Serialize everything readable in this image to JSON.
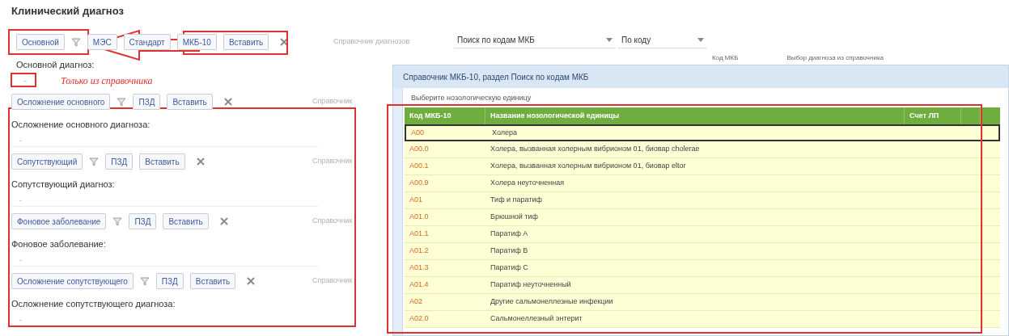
{
  "title": "Клинический диагноз",
  "sections": [
    {
      "buttons": [
        "Основной",
        "МЭС",
        "Стандарт",
        "МКБ-10",
        "Вставить"
      ],
      "reference": "Справочник диагнозов",
      "selects": [
        "Поиск по кодам МКБ",
        "По коду"
      ],
      "label": "Основной диагноз:",
      "value": "-",
      "note": "Только из справочника"
    },
    {
      "buttons": [
        "Осложнение основного",
        "ПЗД",
        "Вставить"
      ],
      "reference": "Справочник",
      "label": "Осложнение основного диагноза:",
      "value": "-"
    },
    {
      "buttons": [
        "Сопутствующий",
        "ПЗД",
        "Вставить"
      ],
      "reference": "Справочник",
      "label": "Сопутствующий диагноз:",
      "value": "-"
    },
    {
      "buttons": [
        "Фоновое заболевание",
        "ПЗД",
        "Вставить"
      ],
      "reference": "Справочник",
      "label": "Фоновое заболевание:",
      "value": "-"
    },
    {
      "buttons": [
        "Осложнение сопутствующего",
        "ПЗД",
        "Вставить"
      ],
      "reference": "Справочник",
      "label": "Осложнение сопутствующего диагноза:",
      "value": "-"
    }
  ],
  "background_labels": [
    "Код МКБ",
    "Выбор диагноза из справочника"
  ],
  "dialog": {
    "title": "Справочник МКБ-10, раздел Поиск по кодам МКБ",
    "subtitle": "Выберите нозологическую единицу",
    "columns": [
      "Код МКБ-10",
      "Название нозологической единицы",
      "Счет ЛП"
    ],
    "rows": [
      {
        "code": "A00",
        "name": "Холера",
        "selected": true
      },
      {
        "code": "A00.0",
        "name": "Холера, вызванная холерным вибрионом 01, биовар cholerae",
        "selected": false
      },
      {
        "code": "A00.1",
        "name": "Холера, вызванная холерным вибрионом 01, биовар eltor",
        "selected": false
      },
      {
        "code": "A00.9",
        "name": "Холера неуточненная",
        "selected": false
      },
      {
        "code": "A01",
        "name": "Тиф и паратиф",
        "selected": false
      },
      {
        "code": "A01.0",
        "name": "Брюшной тиф",
        "selected": false
      },
      {
        "code": "A01.1",
        "name": "Паратиф A",
        "selected": false
      },
      {
        "code": "A01.2",
        "name": "Паратиф B",
        "selected": false
      },
      {
        "code": "A01.3",
        "name": "Паратиф C",
        "selected": false
      },
      {
        "code": "A01.4",
        "name": "Паратиф неуточненный",
        "selected": false
      },
      {
        "code": "A02",
        "name": "Другие сальмонеллезные инфекции",
        "selected": false
      },
      {
        "code": "A02.0",
        "name": "Сальмонеллезный энтерит",
        "selected": false
      }
    ]
  }
}
